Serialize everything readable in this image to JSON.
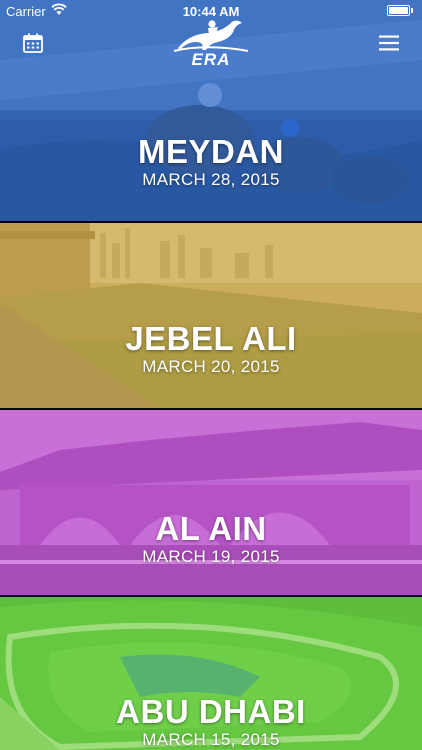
{
  "status_bar": {
    "carrier": "Carrier",
    "time": "10:44 AM"
  },
  "header": {
    "logo_text": "ERA",
    "calendar_icon": "calendar-icon",
    "menu_icon": "hamburger-menu-icon"
  },
  "events": [
    {
      "name": "MEYDAN",
      "date": "MARCH 28, 2015",
      "tint": "#2f6fd0"
    },
    {
      "name": "JEBEL ALI",
      "date": "MARCH 20, 2015",
      "tint": "#d8b34a"
    },
    {
      "name": "AL AIN",
      "date": "MARCH 19, 2015",
      "tint": "#c85ad8"
    },
    {
      "name": "ABU DHABI",
      "date": "MARCH 15, 2015",
      "tint": "#6fce3c"
    }
  ]
}
